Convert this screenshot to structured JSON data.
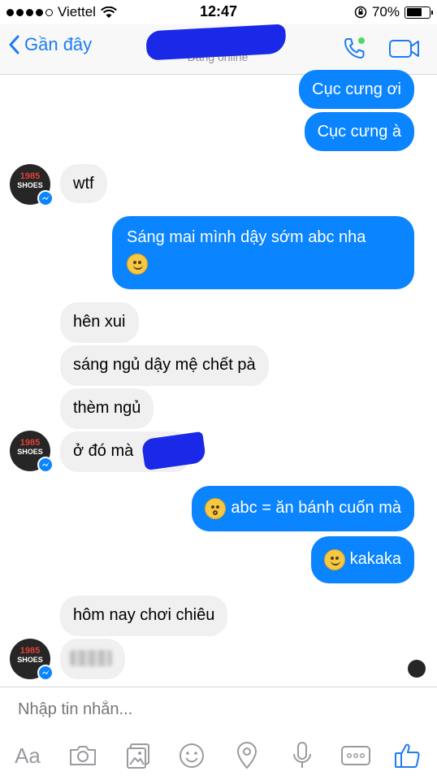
{
  "status_bar": {
    "carrier": "Viettel",
    "time": "12:47",
    "battery_percent": "70%",
    "battery_level": 0.7
  },
  "nav": {
    "back_label": "Gần đây",
    "contact_status": "Đang online"
  },
  "messages": [
    {
      "side": "out",
      "text": "Cục cưng ơi"
    },
    {
      "side": "out",
      "text": "Cục cưng à"
    },
    {
      "side": "in",
      "text": "wtf"
    },
    {
      "side": "out",
      "text": "Sáng mai mình dậy sớm abc nha"
    },
    {
      "side": "in",
      "text": "hên xui"
    },
    {
      "side": "in",
      "text": "sáng ngủ dậy mệ chết pà"
    },
    {
      "side": "in",
      "text": "thèm ngủ"
    },
    {
      "side": "in",
      "text": "ở đó mà"
    },
    {
      "side": "out",
      "text": "abc = ăn bánh cuốn mà"
    },
    {
      "side": "out",
      "text": "kakaka"
    },
    {
      "side": "in",
      "text": "hôm nay chơi chiêu"
    }
  ],
  "avatar": {
    "logo_top": "1985",
    "logo_bottom": "SHOES"
  },
  "composer": {
    "placeholder": "Nhập tin nhắn...",
    "aa_label": "Aa"
  },
  "colors": {
    "accent": "#0a84ff",
    "incoming_bubble": "#f1f0f0",
    "icon_gray": "#9a9aa0"
  }
}
